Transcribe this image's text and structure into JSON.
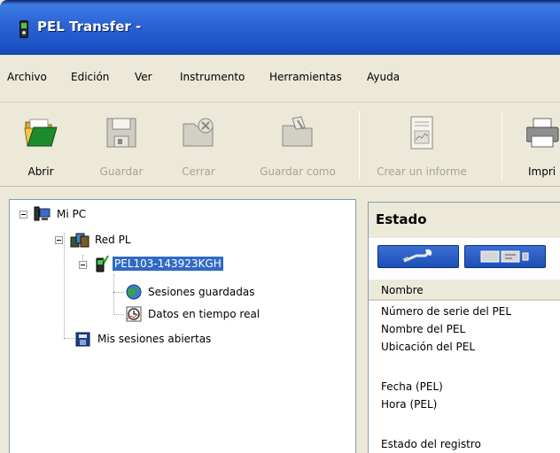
{
  "window": {
    "title": "PEL Transfer -"
  },
  "menu": [
    "Archivo",
    "Edición",
    "Ver",
    "Instrumento",
    "Herramientas",
    "Ayuda"
  ],
  "toolbar": {
    "open": "Abrir",
    "save": "Guardar",
    "close": "Cerrar",
    "save_as": "Guardar como",
    "report": "Crear un informe",
    "print": "Impri"
  },
  "tree": {
    "my_pc": "Mi PC",
    "network": "Red PL",
    "device": "PEL103-143923KGH",
    "saved_sessions": "Sesiones guardadas",
    "realtime": "Datos en tiempo real",
    "open_sessions": "Mis sesiones abiertas"
  },
  "status": {
    "title": "Estado",
    "column": "Nombre",
    "rows": [
      "Número de serie del PEL",
      "Nombre del PEL",
      "Ubicación del PEL",
      "",
      "Fecha (PEL)",
      "Hora (PEL)",
      "",
      "Estado del registro"
    ]
  },
  "colors": {
    "title_bar": "#2a63d6",
    "selection": "#316ac5",
    "panel_border": "#7f9db9"
  }
}
